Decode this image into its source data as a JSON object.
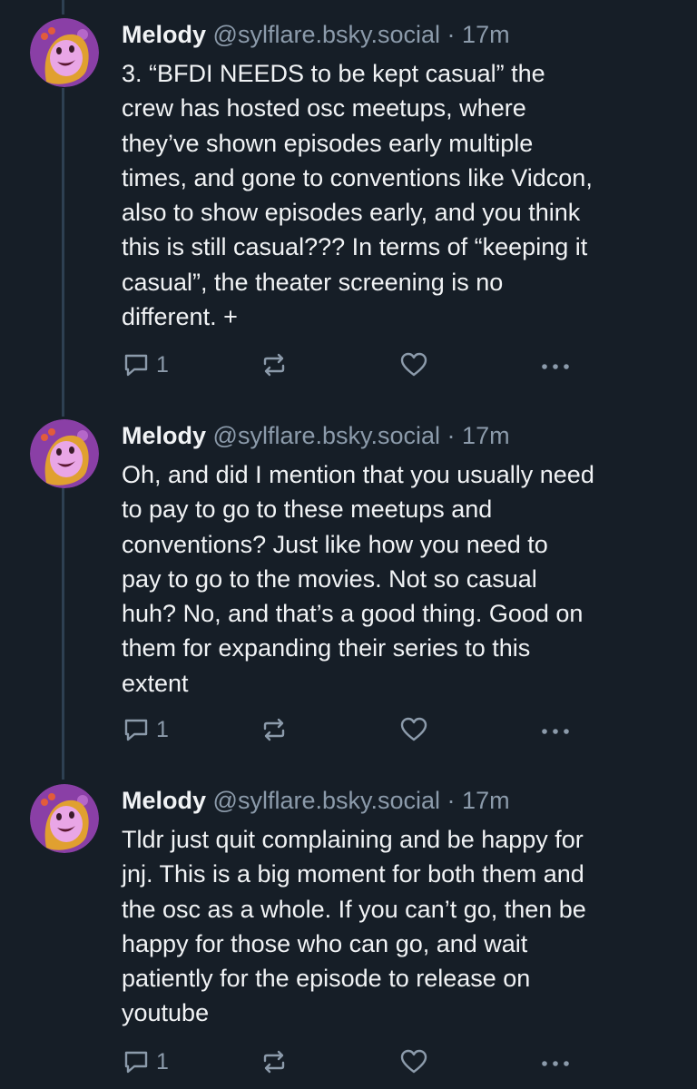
{
  "posts": [
    {
      "author": "Melody",
      "handle": "@sylflare.bsky.social",
      "separator": "·",
      "time": "17m",
      "lines": [
        "3. “BFDI NEEDS to be kept casual” the",
        "crew has hosted osc meetups, where",
        "they’ve shown episodes early multiple",
        "times, and gone to conventions like Vidcon,",
        "also to show episodes early, and you think",
        "this is still casual??? In terms of “keeping it",
        "casual”, the theater screening is no",
        "different. +"
      ],
      "reply_count": "1",
      "icons": [
        "reply-icon",
        "repost-icon",
        "like-icon",
        "more-icon"
      ]
    },
    {
      "author": "Melody",
      "handle": "@sylflare.bsky.social",
      "separator": "·",
      "time": "17m",
      "lines": [
        "Oh, and did I mention that you usually need",
        "to pay to go to these meetups and",
        "conventions? Just like how you need to",
        "pay to go to the movies. Not so casual",
        "huh? No, and that’s a good thing. Good on",
        "them for expanding their series to this",
        "extent"
      ],
      "reply_count": "1",
      "icons": [
        "reply-icon",
        "repost-icon",
        "like-icon",
        "more-icon"
      ]
    },
    {
      "author": "Melody",
      "handle": "@sylflare.bsky.social",
      "separator": "·",
      "time": "17m",
      "lines": [
        "Tldr just quit complaining and be happy for",
        "jnj. This is a big moment for both them and",
        "the osc as a whole. If you can’t go, then be",
        "happy for those who can go, and wait",
        "patiently for the episode to release on",
        "youtube"
      ],
      "reply_count": "1",
      "icons": [
        "reply-icon",
        "repost-icon",
        "like-icon",
        "more-icon"
      ]
    }
  ],
  "colors": {
    "background": "#161e27",
    "text": "#f1f3f5",
    "muted": "#8c9bab",
    "thread_line": "#2e4052",
    "avatar_bg": "#8a3fa6"
  }
}
